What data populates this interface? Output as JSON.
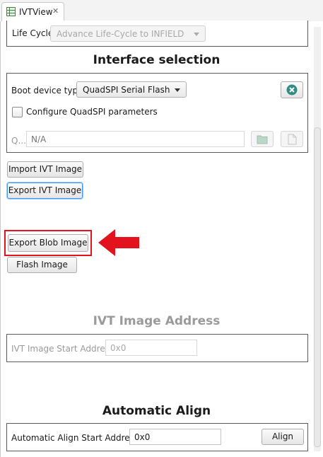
{
  "tab": {
    "label": "IVTView",
    "icon": "table-view-icon",
    "close_icon": "close-icon"
  },
  "colors": {
    "annotation_red": "#e3131e",
    "clear_icon_teal": "#2f8d86",
    "focus_blue": "#3b99fc"
  },
  "life_cycle": {
    "label": "Life Cycle",
    "value": "Advance Life-Cycle to INFIELD"
  },
  "interface_selection": {
    "title": "Interface selection",
    "boot_device_label": "Boot device type",
    "boot_device_value": "QuadSPI Serial Flash",
    "configure_checkbox_label": "Configure QuadSPI parameters",
    "configure_checked": false,
    "path_label": "Q...",
    "path_placeholder": "N/A"
  },
  "buttons": {
    "import_ivt": "Import IVT Image",
    "export_ivt": "Export IVT Image",
    "export_blob": "Export Blob Image",
    "flash_image": "Flash Image"
  },
  "ivt_image_address": {
    "title": "IVT Image Address",
    "start_label": "IVT Image Start Address",
    "start_value": "0x0"
  },
  "automatic_align": {
    "title": "Automatic Align",
    "start_label": "Automatic Align Start Address:",
    "start_value": "0x0",
    "align_button": "Align"
  }
}
